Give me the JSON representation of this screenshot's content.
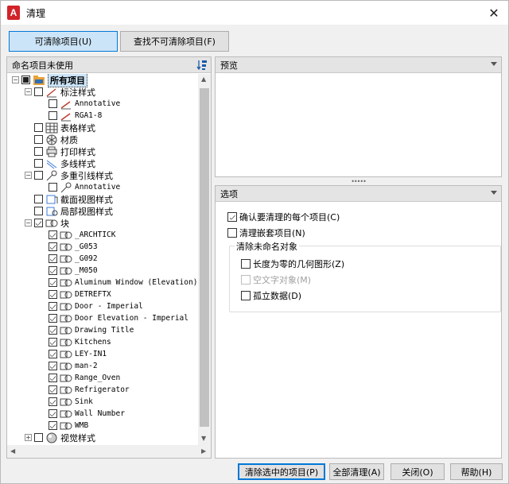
{
  "window": {
    "title": "清理",
    "app_icon_letter": "A"
  },
  "tabs": [
    {
      "label": "可清除项目(U)",
      "active": true
    },
    {
      "label": "查找不可清除项目(F)",
      "active": false
    }
  ],
  "left_panel": {
    "header": "命名项目未使用"
  },
  "tree": [
    {
      "label": "所有项目",
      "level": 0,
      "expand": "-",
      "check": "fill",
      "icon": "folder-icon",
      "selected": true,
      "mono": false
    },
    {
      "label": "标注样式",
      "level": 1,
      "expand": "-",
      "check": "none",
      "icon": "dimension-style-icon",
      "mono": false
    },
    {
      "label": "Annotative",
      "level": 2,
      "expand": "",
      "check": "none",
      "icon": "dimension-icon",
      "mono": true
    },
    {
      "label": "RGA1-8",
      "level": 2,
      "expand": "",
      "check": "none",
      "icon": "dimension-icon",
      "mono": true
    },
    {
      "label": "表格样式",
      "level": 1,
      "expand": "",
      "check": "none",
      "icon": "table-style-icon",
      "mono": false
    },
    {
      "label": "材质",
      "level": 1,
      "expand": "",
      "check": "none",
      "icon": "material-icon",
      "mono": false
    },
    {
      "label": "打印样式",
      "level": 1,
      "expand": "",
      "check": "none",
      "icon": "plot-style-icon",
      "mono": false
    },
    {
      "label": "多线样式",
      "level": 1,
      "expand": "",
      "check": "none",
      "icon": "multiline-style-icon",
      "mono": false
    },
    {
      "label": "多重引线样式",
      "level": 1,
      "expand": "-",
      "check": "none",
      "icon": "multileader-style-icon",
      "mono": false
    },
    {
      "label": "Annotative",
      "level": 2,
      "expand": "",
      "check": "none",
      "icon": "multileader-icon",
      "mono": true
    },
    {
      "label": "截面视图样式",
      "level": 1,
      "expand": "",
      "check": "none",
      "icon": "section-view-icon",
      "mono": false
    },
    {
      "label": "局部视图样式",
      "level": 1,
      "expand": "",
      "check": "none",
      "icon": "detail-view-icon",
      "mono": false
    },
    {
      "label": "块",
      "level": 1,
      "expand": "-",
      "check": "chk",
      "icon": "block-icon",
      "mono": false
    },
    {
      "label": "_ARCHTICK",
      "level": 2,
      "expand": "",
      "check": "chk",
      "icon": "block-icon",
      "mono": true
    },
    {
      "label": "_G053",
      "level": 2,
      "expand": "",
      "check": "chk",
      "icon": "block-icon",
      "mono": true
    },
    {
      "label": "_G092",
      "level": 2,
      "expand": "",
      "check": "chk",
      "icon": "block-icon",
      "mono": true
    },
    {
      "label": "_M050",
      "level": 2,
      "expand": "",
      "check": "chk",
      "icon": "block-icon",
      "mono": true
    },
    {
      "label": "Aluminum Window (Elevation)",
      "level": 2,
      "expand": "",
      "check": "chk",
      "icon": "block-icon",
      "mono": true
    },
    {
      "label": "DETREFTX",
      "level": 2,
      "expand": "",
      "check": "chk",
      "icon": "block-icon",
      "mono": true
    },
    {
      "label": "Door - Imperial",
      "level": 2,
      "expand": "",
      "check": "chk",
      "icon": "block-icon",
      "mono": true
    },
    {
      "label": "Door Elevation - Imperial",
      "level": 2,
      "expand": "",
      "check": "chk",
      "icon": "block-icon",
      "mono": true
    },
    {
      "label": "Drawing Title",
      "level": 2,
      "expand": "",
      "check": "chk",
      "icon": "block-icon",
      "mono": true
    },
    {
      "label": "Kitchens",
      "level": 2,
      "expand": "",
      "check": "chk",
      "icon": "block-icon",
      "mono": true
    },
    {
      "label": "LEY-IN1",
      "level": 2,
      "expand": "",
      "check": "chk",
      "icon": "block-icon",
      "mono": true
    },
    {
      "label": "man-2",
      "level": 2,
      "expand": "",
      "check": "chk",
      "icon": "block-icon",
      "mono": true
    },
    {
      "label": "Range_Oven",
      "level": 2,
      "expand": "",
      "check": "chk",
      "icon": "block-icon",
      "mono": true
    },
    {
      "label": "Refrigerator",
      "level": 2,
      "expand": "",
      "check": "chk",
      "icon": "block-icon",
      "mono": true
    },
    {
      "label": "Sink",
      "level": 2,
      "expand": "",
      "check": "chk",
      "icon": "block-icon",
      "mono": true
    },
    {
      "label": "Wall Number",
      "level": 2,
      "expand": "",
      "check": "chk",
      "icon": "block-icon",
      "mono": true
    },
    {
      "label": "WMB",
      "level": 2,
      "expand": "",
      "check": "chk",
      "icon": "block-icon",
      "mono": true
    },
    {
      "label": "视觉样式",
      "level": 1,
      "expand": "+",
      "check": "none",
      "icon": "visual-style-icon",
      "mono": false
    }
  ],
  "preview_panel": {
    "header": "预览"
  },
  "options_panel": {
    "header": "选项",
    "confirm": {
      "label": "确认要清理的每个项目(C)",
      "checked": true
    },
    "nested": {
      "label": "清理嵌套项目(N)",
      "checked": false
    },
    "group_title": "清除未命名对象",
    "zero_length": {
      "label": "长度为零的几何图形(Z)",
      "checked": false
    },
    "empty_text": {
      "label": "空文字对象(M)",
      "checked": false,
      "disabled": true
    },
    "orphaned": {
      "label": "孤立数据(D)",
      "checked": false
    }
  },
  "buttons": {
    "purge_checked": "清除选中的项目(P)",
    "purge_all": "全部清理(A)",
    "close": "关闭(O)",
    "help": "帮助(H)"
  },
  "colors": {
    "accent": "#0078d7",
    "selection": "#cce4f7",
    "brand": "#d2232a"
  }
}
